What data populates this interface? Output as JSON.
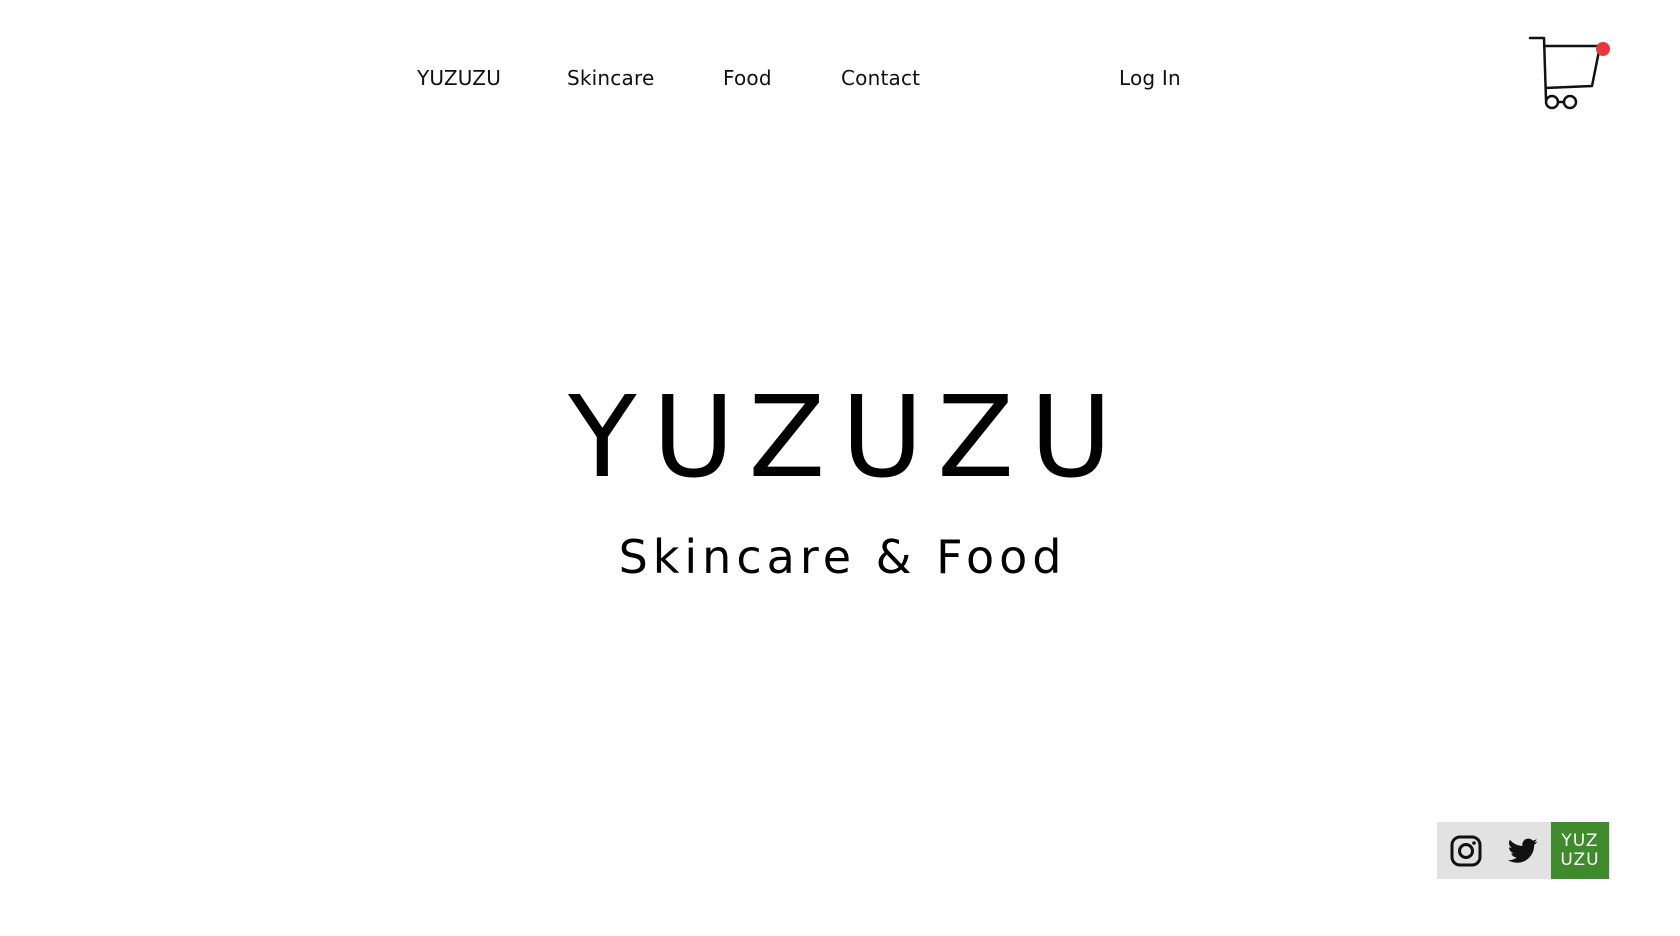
{
  "nav": {
    "items": [
      {
        "label": "YUZUZU"
      },
      {
        "label": "Skincare"
      },
      {
        "label": "Food"
      },
      {
        "label": "Contact"
      }
    ],
    "login_label": "Log In"
  },
  "cart": {
    "icon": "shopping-cart-icon",
    "has_notification": true,
    "notification_color": "#e8383d"
  },
  "hero": {
    "title": "YUZUZU",
    "subtitle": "Skincare & Food"
  },
  "social": {
    "items": [
      {
        "icon": "instagram-icon"
      },
      {
        "icon": "twitter-icon"
      },
      {
        "icon": "yuzuzu-logo-icon",
        "lines": [
          "YUZ",
          "UZU"
        ],
        "color": "#3e8a2c"
      }
    ]
  }
}
